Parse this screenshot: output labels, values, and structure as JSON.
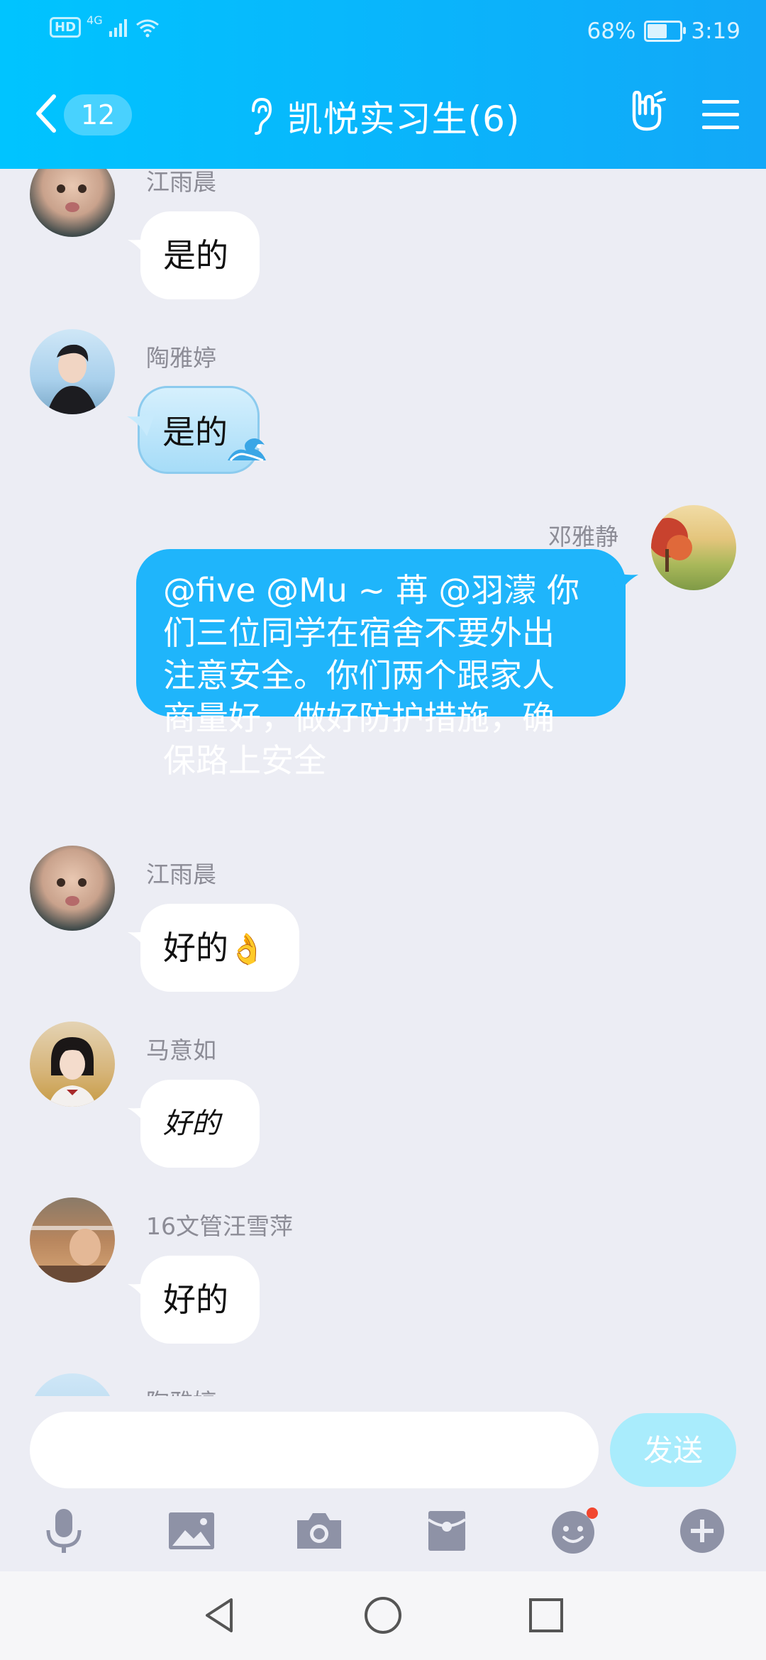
{
  "status_bar": {
    "hd": "HD",
    "network": "4G",
    "battery_percent": "68%",
    "battery_level": 0.68,
    "time": "3:19"
  },
  "header": {
    "unread_count": "12",
    "title": "凯悦实习生(6)",
    "icons": [
      "back-icon",
      "ear-icon",
      "hand-icon",
      "menu-icon"
    ]
  },
  "messages": [
    {
      "sender": "江雨晨",
      "text": "是的"
    },
    {
      "sender": "陶雅婷",
      "text": "是的"
    },
    {
      "sender": "邓雅静",
      "text": "@five @Mu ~ 苒 @羽濛 你们三位同学在宿舍不要外出注意安全。你们两个跟家人商量好，做好防护措施，确保路上安全",
      "self": true
    },
    {
      "sender": "江雨晨",
      "text": "好的",
      "emoji": "👌"
    },
    {
      "sender": "马意如",
      "text": "好的"
    },
    {
      "sender": "16文管汪雪萍",
      "text": "好的"
    },
    {
      "sender": "陶雅婷",
      "text": ""
    }
  ],
  "input": {
    "placeholder": "",
    "send_label": "发送"
  },
  "toolbar_icons": [
    "microphone-icon",
    "image-icon",
    "camera-icon",
    "red-packet-icon",
    "emoji-icon",
    "plus-icon"
  ],
  "colors": {
    "header": "#12a8f8",
    "self_bubble": "#1fb5fb",
    "send_button": "#a9ecfc",
    "background": "#ecedf4"
  }
}
